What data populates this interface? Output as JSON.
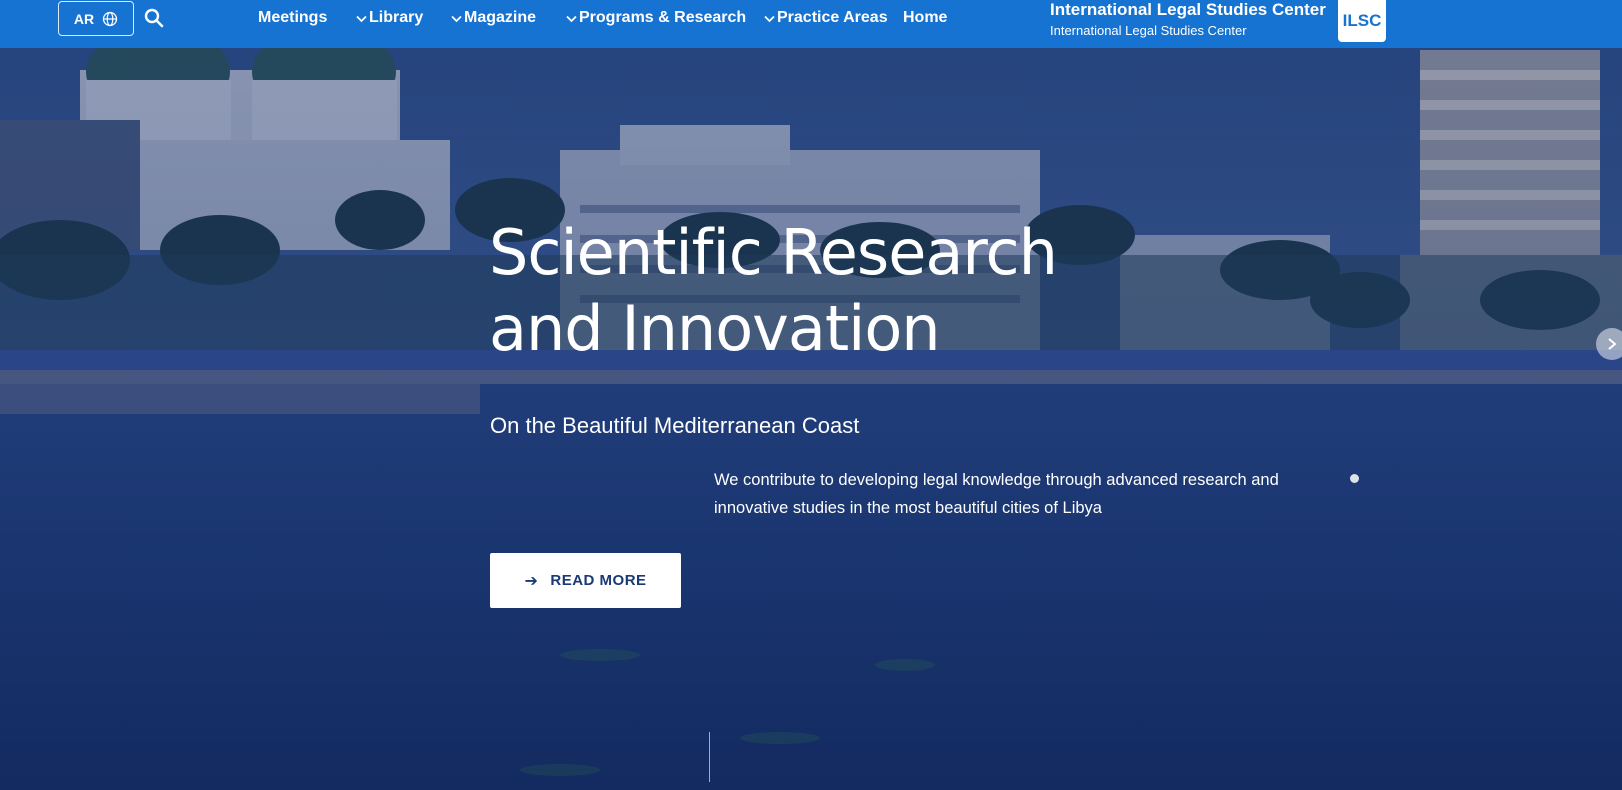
{
  "header": {
    "lang_label": "AR",
    "nav": [
      {
        "label": "Meetings",
        "has_dropdown": false
      },
      {
        "label": "Library",
        "has_dropdown": true
      },
      {
        "label": "Magazine",
        "has_dropdown": true
      },
      {
        "label": "Programs & Research",
        "has_dropdown": true
      },
      {
        "label": "Practice Areas",
        "has_dropdown": true
      },
      {
        "label": "Home",
        "has_dropdown": false
      }
    ],
    "brand_title": "International Legal Studies Center",
    "brand_subtitle": "International Legal Studies Center",
    "logo_text": "ILSC"
  },
  "hero": {
    "title": "Scientific Research and Innovation",
    "subtitle": "On the Beautiful Mediterranean Coast",
    "description": "We contribute to developing legal knowledge through advanced research and innovative studies in the most beautiful cities of Libya",
    "cta_label": "READ MORE"
  },
  "colors": {
    "nav_bg": "#1673d1",
    "cta_text": "#1a3a75",
    "overlay": "#142d69"
  },
  "icons": {
    "lang": "globe-icon",
    "search": "search-icon",
    "cta": "arrow-right-icon",
    "slider_next": "chevron-right-icon"
  }
}
